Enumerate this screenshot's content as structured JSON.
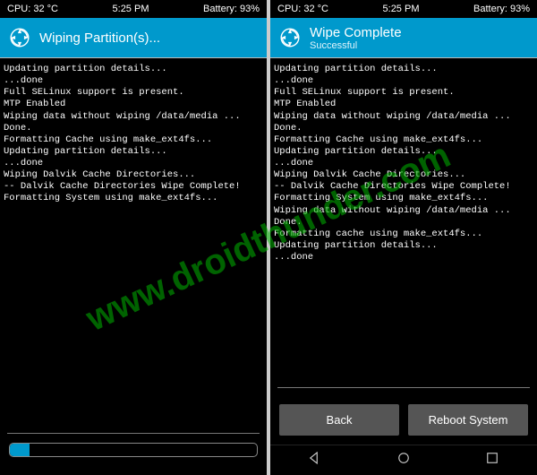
{
  "statusbar": {
    "cpu": "CPU: 32 °C",
    "time": "5:25 PM",
    "battery": "Battery: 93%"
  },
  "left": {
    "title": "Wiping Partition(s)...",
    "terminal": "Updating partition details...\n...done\nFull SELinux support is present.\nMTP Enabled\nWiping data without wiping /data/media ...\nDone.\nFormatting Cache using make_ext4fs...\nUpdating partition details...\n...done\nWiping Dalvik Cache Directories...\n-- Dalvik Cache Directories Wipe Complete!\nFormatting System using make_ext4fs..."
  },
  "right": {
    "title": "Wipe Complete",
    "subtitle": "Successful",
    "terminal": "Updating partition details...\n...done\nFull SELinux support is present.\nMTP Enabled\nWiping data without wiping /data/media ...\nDone.\nFormatting Cache using make_ext4fs...\nUpdating partition details...\n...done\nWiping Dalvik Cache Directories...\n-- Dalvik Cache Directories Wipe Complete!\nFormatting System using make_ext4fs...\nWiping data without wiping /data/media ...\nDone.\nFormatting cache using make_ext4fs...\nUpdating partition details...\n...done",
    "buttons": {
      "back": "Back",
      "reboot": "Reboot System"
    }
  },
  "watermark": "www.droidthunder.com"
}
